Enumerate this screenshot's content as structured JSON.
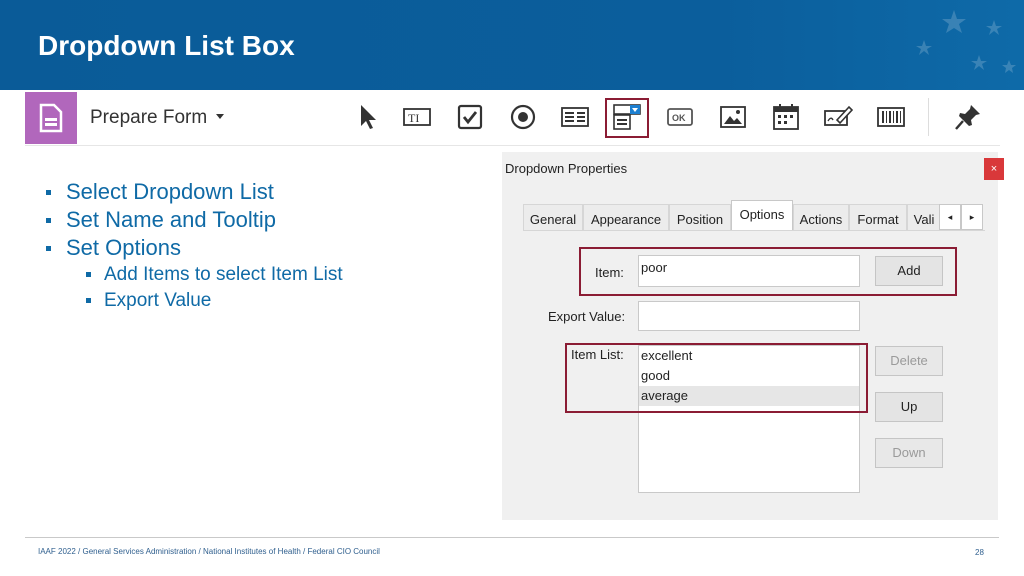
{
  "slide": {
    "title": "Dropdown List Box"
  },
  "toolbar": {
    "label": "Prepare Form",
    "icons": [
      "select-arrow-icon",
      "text-field-icon",
      "checkbox-icon",
      "radio-button-icon",
      "list-box-icon",
      "dropdown-icon",
      "button-ok-icon",
      "image-icon",
      "date-field-icon",
      "signature-icon",
      "barcode-icon",
      "pin-icon"
    ],
    "tool_labels": {
      "text_field": "TI",
      "ok_button": "OK"
    }
  },
  "bullets": [
    {
      "level": 1,
      "text": "Select Dropdown List"
    },
    {
      "level": 1,
      "text": "Set Name and Tooltip"
    },
    {
      "level": 1,
      "text": "Set Options"
    },
    {
      "level": 2,
      "text": "Add Items to select Item List"
    },
    {
      "level": 2,
      "text": "Export Value"
    }
  ],
  "dialog": {
    "title": "Dropdown Properties",
    "close_label": "×",
    "tabs": [
      "General",
      "Appearance",
      "Position",
      "Options",
      "Actions",
      "Format",
      "Vali"
    ],
    "active_tab": "Options",
    "tab_scroll_left": "◂",
    "tab_scroll_right": "▸",
    "item_label": "Item:",
    "item_value": "poor",
    "add_button": "Add",
    "export_label": "Export Value:",
    "export_value": "",
    "item_list_label": "Item List:",
    "item_list": [
      "excellent",
      "good",
      "average"
    ],
    "selected_item": "average",
    "delete_button": "Delete",
    "up_button": "Up",
    "down_button": "Down"
  },
  "footer": {
    "text": "IAAF 2022  /  General Services Administration  /  National Institutes of Health  /  Federal CIO Council",
    "page": "28"
  },
  "colors": {
    "header_blue": "#0b5e9c",
    "bullet_blue": "#0f6aa6",
    "highlight_red": "#8b1c34",
    "form_purple": "#b167bc"
  }
}
